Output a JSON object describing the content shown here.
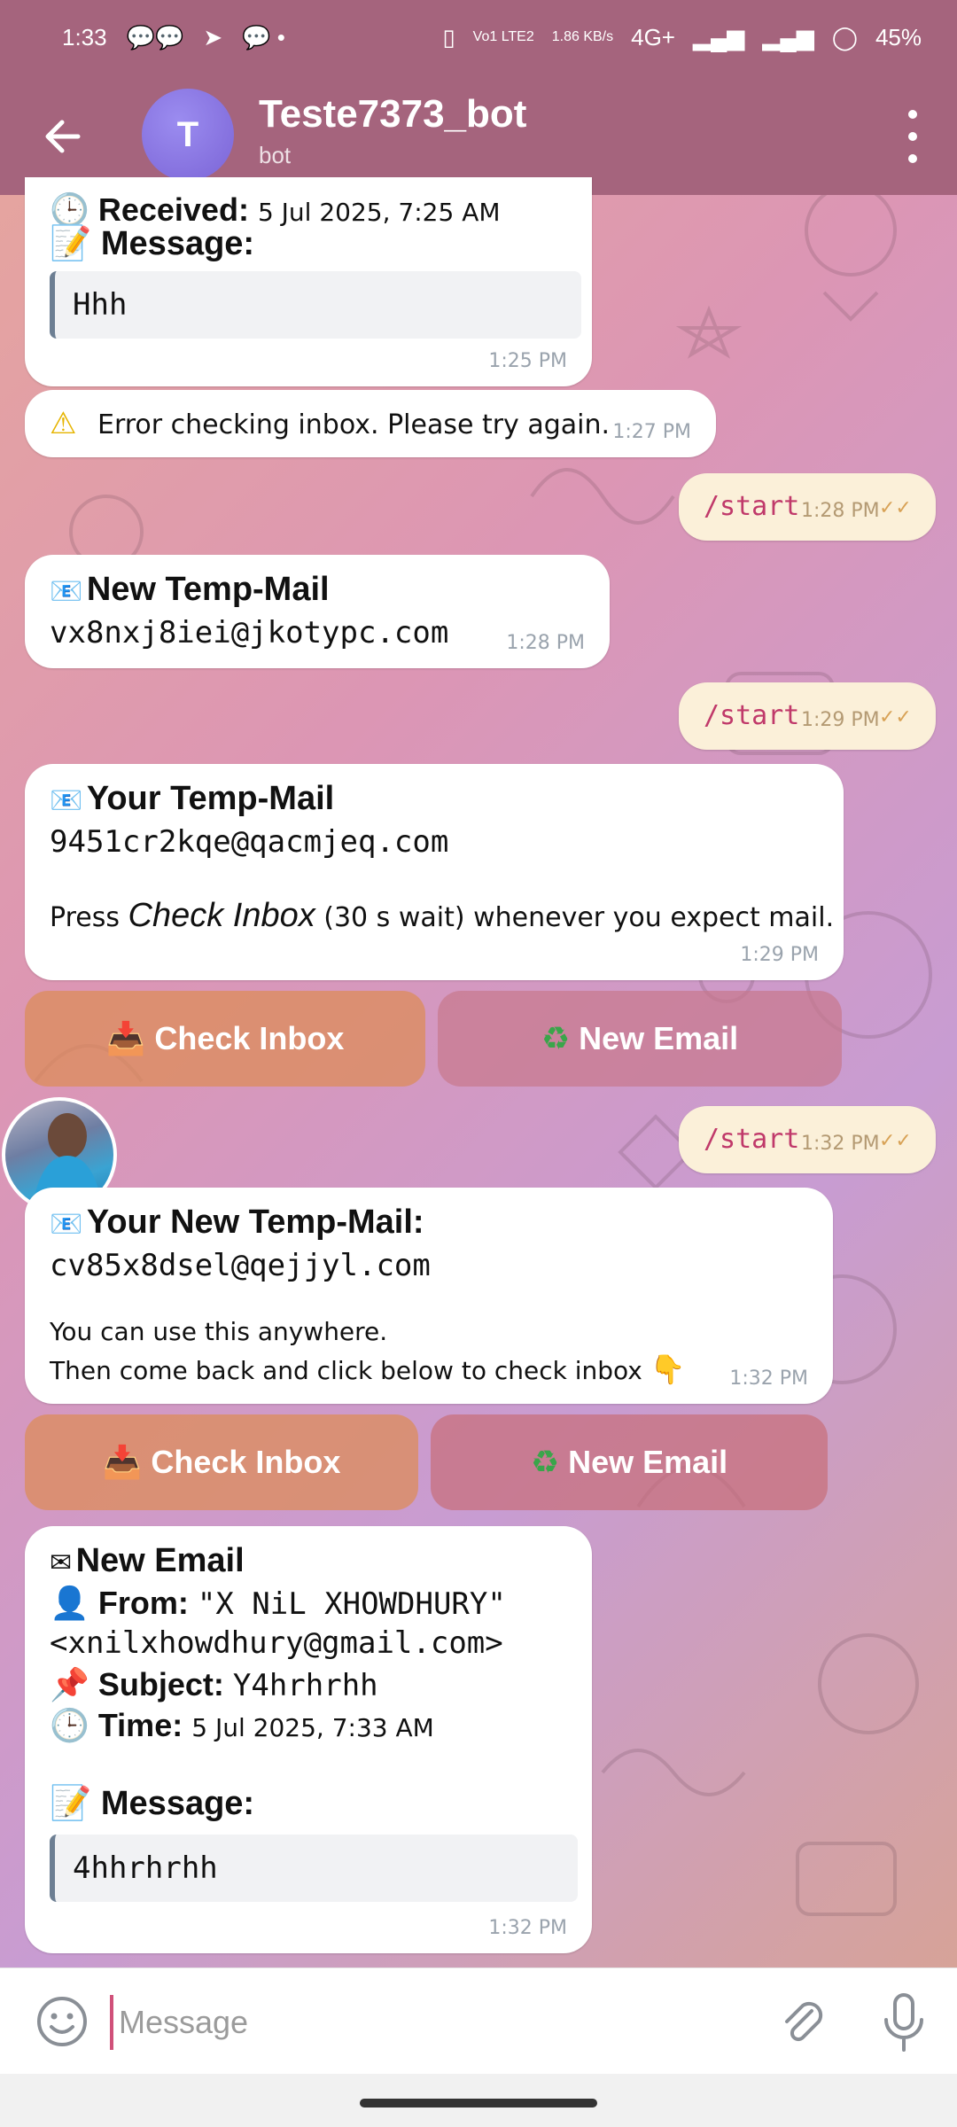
{
  "status": {
    "time": "1:33",
    "network": "4G+",
    "speed": "1.86 KB/s",
    "volte": "Vo1 LTE2",
    "battery": "45%"
  },
  "header": {
    "avatar_letter": "T",
    "title": "Teste7373_bot",
    "subtitle": "bot"
  },
  "messages": {
    "m1": {
      "received_label": "Received:",
      "received_value": "5 Jul 2025, 7:25 AM",
      "message_label": "Message:",
      "quote": "Hhh",
      "time": "1:25 PM"
    },
    "m2": {
      "text": "Error checking inbox. Please try again.",
      "time": "1:27 PM"
    },
    "m3": {
      "text": "/start",
      "time": "1:28 PM"
    },
    "m4": {
      "title": "New Temp-Mail",
      "email": "vx8nxj8iei@jkotypc.com",
      "time": "1:28 PM"
    },
    "m5": {
      "text": "/start",
      "time": "1:29 PM"
    },
    "m6": {
      "title": "Your Temp-Mail",
      "email": "9451cr2kqe@qacmjeq.com",
      "line_a": "Press ",
      "line_b": "Check Inbox",
      "line_c": " (30 s wait) whenever you expect mail.",
      "time": "1:29 PM",
      "btn_check": "Check Inbox",
      "btn_new": "New Email"
    },
    "m7": {
      "text": "/start",
      "time": "1:32 PM"
    },
    "m8": {
      "title": "Your New Temp-Mail:",
      "email": "cv85x8dsel@qejjyl.com",
      "line1": "You can use this anywhere.",
      "line2": "Then come back and click below to check inbox",
      "time": "1:32 PM",
      "btn_check": "Check Inbox",
      "btn_new": "New Email"
    },
    "m9": {
      "title": "New Email",
      "from_label": "From:",
      "from_name": "\"X NiL XHOWDHURY\"",
      "from_addr": "<xnilxhowdhury@gmail.com>",
      "subject_label": "Subject:",
      "subject": "Y4hrhrhh",
      "time_label": "Time:",
      "time_value": "5 Jul 2025, 7:33 AM",
      "message_label": "Message:",
      "quote": "4hhrhrhh",
      "time": "1:32 PM"
    }
  },
  "input": {
    "placeholder": "Message"
  },
  "colors": {
    "header": "#a5647d",
    "accent": "#d0517a",
    "outgoing_bubble": "#fbf0d9"
  }
}
